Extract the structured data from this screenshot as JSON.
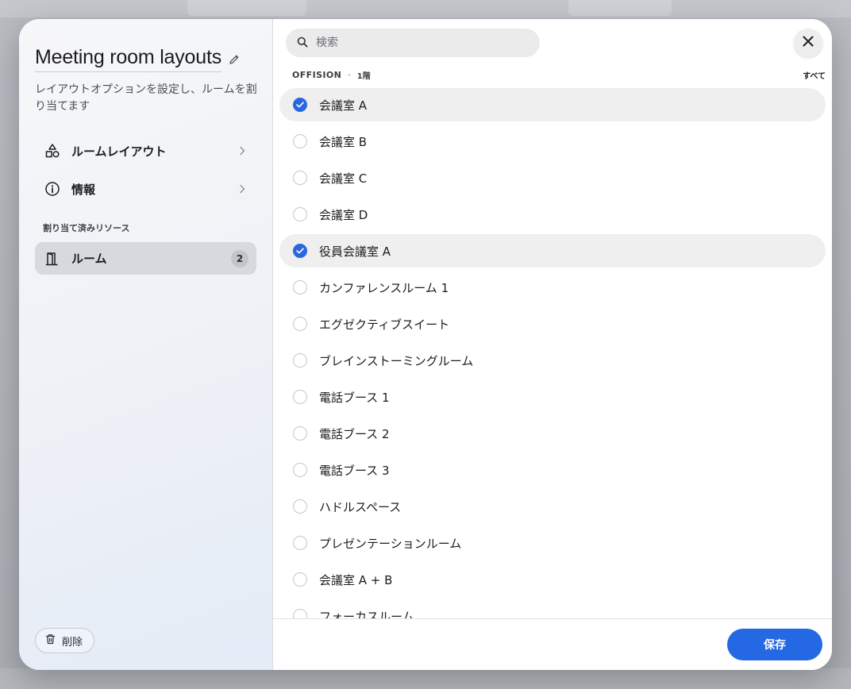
{
  "panel": {
    "title": "Meeting room layouts",
    "description": "レイアウトオプションを設定し、ルームを割り当てます",
    "nav": [
      {
        "label": "ルームレイアウト",
        "icon": "shapes-icon"
      },
      {
        "label": "情報",
        "icon": "info-icon"
      }
    ],
    "section_label": "割り当て済みリソース",
    "resource": {
      "label": "ルーム",
      "count": "2",
      "icon": "door-icon"
    },
    "delete_label": "削除"
  },
  "search": {
    "placeholder": "検索",
    "value": ""
  },
  "list": {
    "group": "OFFISION",
    "separator": "·",
    "floor": "1階",
    "select_all": "すべて",
    "rooms": [
      {
        "label": "会議室 A",
        "selected": true
      },
      {
        "label": "会議室 B",
        "selected": false
      },
      {
        "label": "会議室 C",
        "selected": false
      },
      {
        "label": "会議室 D",
        "selected": false
      },
      {
        "label": "役員会議室 A",
        "selected": true
      },
      {
        "label": "カンファレンスルーム 1",
        "selected": false
      },
      {
        "label": "エグゼクティブスイート",
        "selected": false
      },
      {
        "label": "ブレインストーミングルーム",
        "selected": false
      },
      {
        "label": "電話ブース 1",
        "selected": false
      },
      {
        "label": "電話ブース 2",
        "selected": false
      },
      {
        "label": "電話ブース 3",
        "selected": false
      },
      {
        "label": "ハドルスペース",
        "selected": false
      },
      {
        "label": "プレゼンテーションルーム",
        "selected": false
      },
      {
        "label": "会議室 A + B",
        "selected": false
      },
      {
        "label": "フォーカスルーム",
        "selected": false
      }
    ]
  },
  "footer": {
    "save_label": "保存"
  },
  "colors": {
    "accent": "#2468e4",
    "selected_row": "#efeff0"
  }
}
